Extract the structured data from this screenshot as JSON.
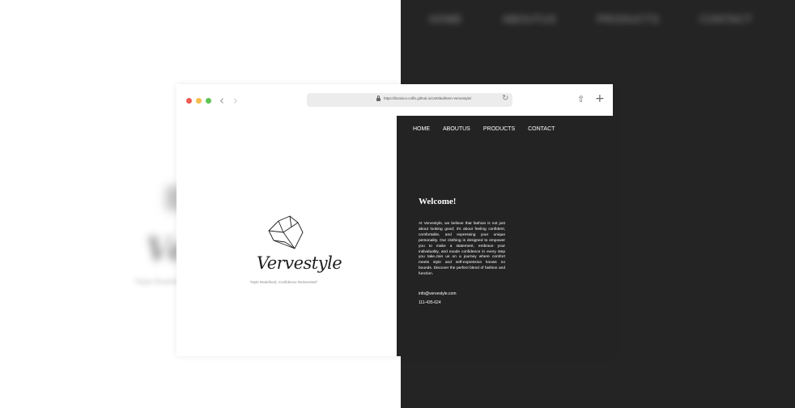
{
  "background": {
    "blurred_nav": [
      "HOME",
      "ABOUTUS",
      "PRODUCTS",
      "CONTACT"
    ]
  },
  "browser": {
    "url": "https://bonisco.coffe.github.io/Untitled/Item-Vervestyle/",
    "controls": {
      "back": "‹",
      "forward": "›",
      "reload": "↻",
      "share": "⇧",
      "new_tab": "+"
    }
  },
  "site": {
    "nav": [
      "HOME",
      "ABOUTUS",
      "PRODUCTS",
      "CONTACT"
    ],
    "brand": "Vervestyle",
    "tagline": "\"Style Redefined, Confidence Reinvented\"",
    "welcome_title": "Welcome!",
    "about_text": "At Vervestyle, we believe that fashion is not just about looking good; it's about feeling confident, comfortable, and expressing your unique personality. Our clothing is designed to empower you to make a statement, embrace your individuality, and exude confidence in every step you take.Join us on a journey where comfort meets style and self-expression knows no bounds. Discover the perfect blend of fashion and function.",
    "email": "info@vervestyle.com",
    "phone": "111-435-624"
  },
  "colors": {
    "dark_panel": "#232323",
    "traffic_red": "#ee5a52",
    "traffic_yellow": "#f5be4f",
    "traffic_green": "#5fc454"
  }
}
